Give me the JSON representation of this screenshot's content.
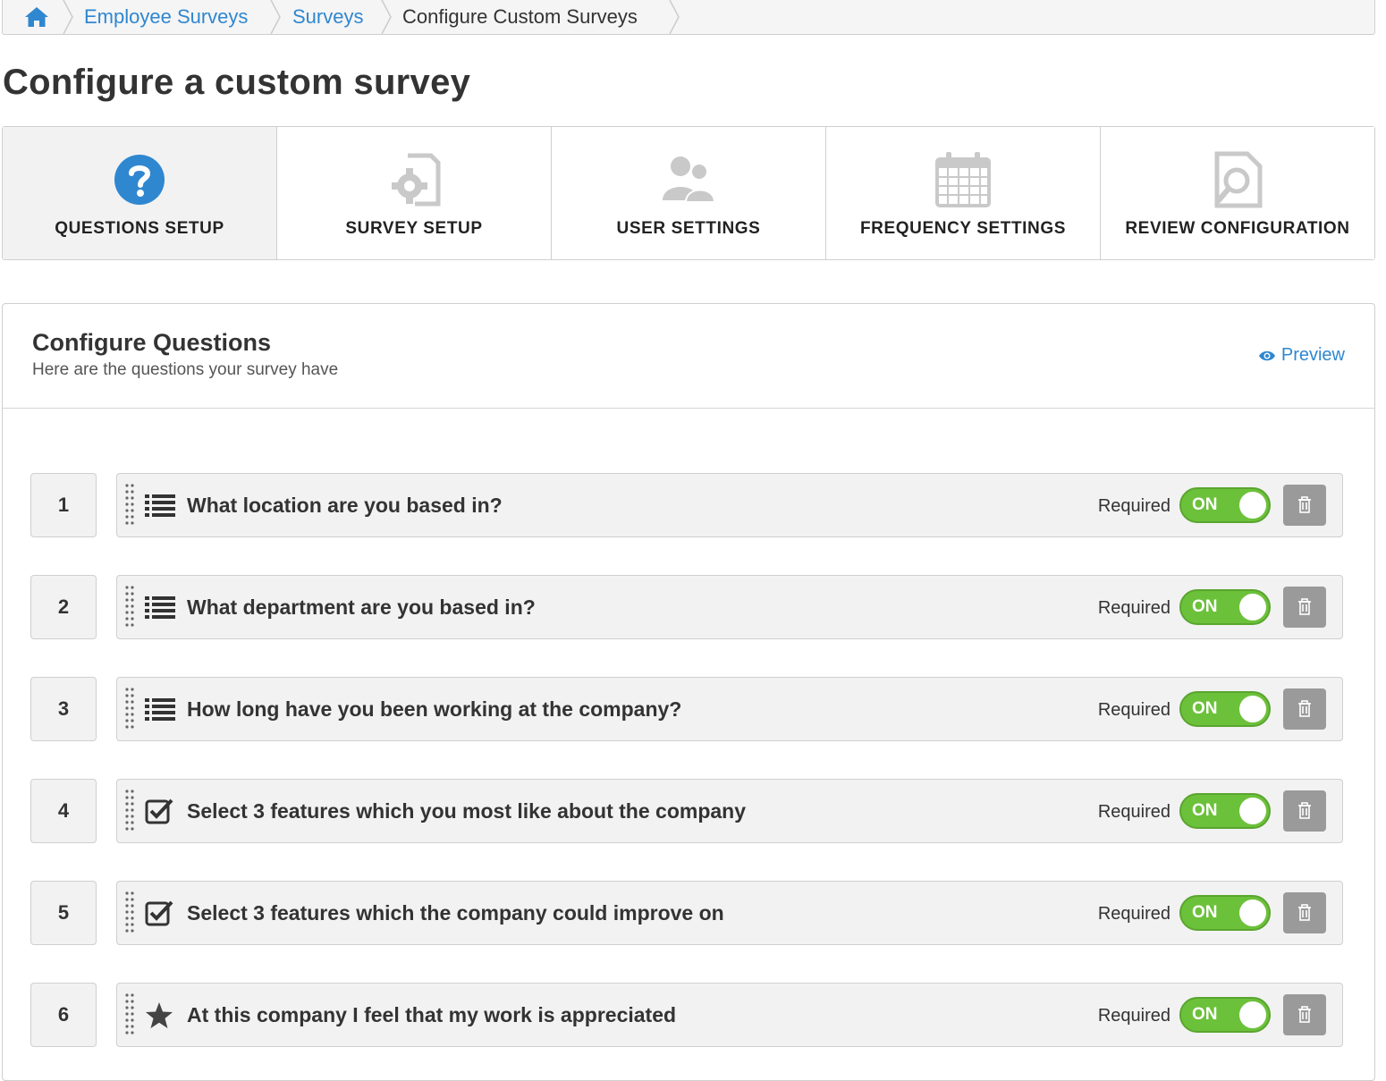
{
  "breadcrumb": {
    "items": [
      {
        "label": "Employee Surveys"
      },
      {
        "label": "Surveys"
      },
      {
        "label": "Configure Custom Surveys"
      }
    ]
  },
  "page": {
    "title": "Configure a custom survey"
  },
  "steps": [
    {
      "label": "QUESTIONS SETUP",
      "icon": "question-circle-icon",
      "active": true
    },
    {
      "label": "SURVEY SETUP",
      "icon": "document-gear-icon",
      "active": false
    },
    {
      "label": "USER SETTINGS",
      "icon": "users-icon",
      "active": false
    },
    {
      "label": "FREQUENCY SETTINGS",
      "icon": "calendar-icon",
      "active": false
    },
    {
      "label": "REVIEW CONFIGURATION",
      "icon": "document-search-icon",
      "active": false
    }
  ],
  "panel": {
    "title": "Configure Questions",
    "subtitle": "Here are the questions your survey have",
    "preview_label": "Preview"
  },
  "questions": [
    {
      "number": "1",
      "text": "What location are you based in?",
      "type_icon": "list-icon",
      "required_label": "Required",
      "toggle_label": "ON"
    },
    {
      "number": "2",
      "text": "What department are you based in?",
      "type_icon": "list-icon",
      "required_label": "Required",
      "toggle_label": "ON"
    },
    {
      "number": "3",
      "text": "How long have you been working at the company?",
      "type_icon": "list-icon",
      "required_label": "Required",
      "toggle_label": "ON"
    },
    {
      "number": "4",
      "text": "Select 3 features which you most like about the company",
      "type_icon": "checkbox-icon",
      "required_label": "Required",
      "toggle_label": "ON"
    },
    {
      "number": "5",
      "text": "Select 3 features which the company could improve on",
      "type_icon": "checkbox-icon",
      "required_label": "Required",
      "toggle_label": "ON"
    },
    {
      "number": "6",
      "text": "At this company I feel that my work is appreciated",
      "type_icon": "star-icon",
      "required_label": "Required",
      "toggle_label": "ON"
    }
  ],
  "colors": {
    "link": "#2f87d0",
    "toggle_on": "#6cc13a",
    "active_step_bg": "#f2f2f2",
    "question_icon": "#2f87d0"
  }
}
